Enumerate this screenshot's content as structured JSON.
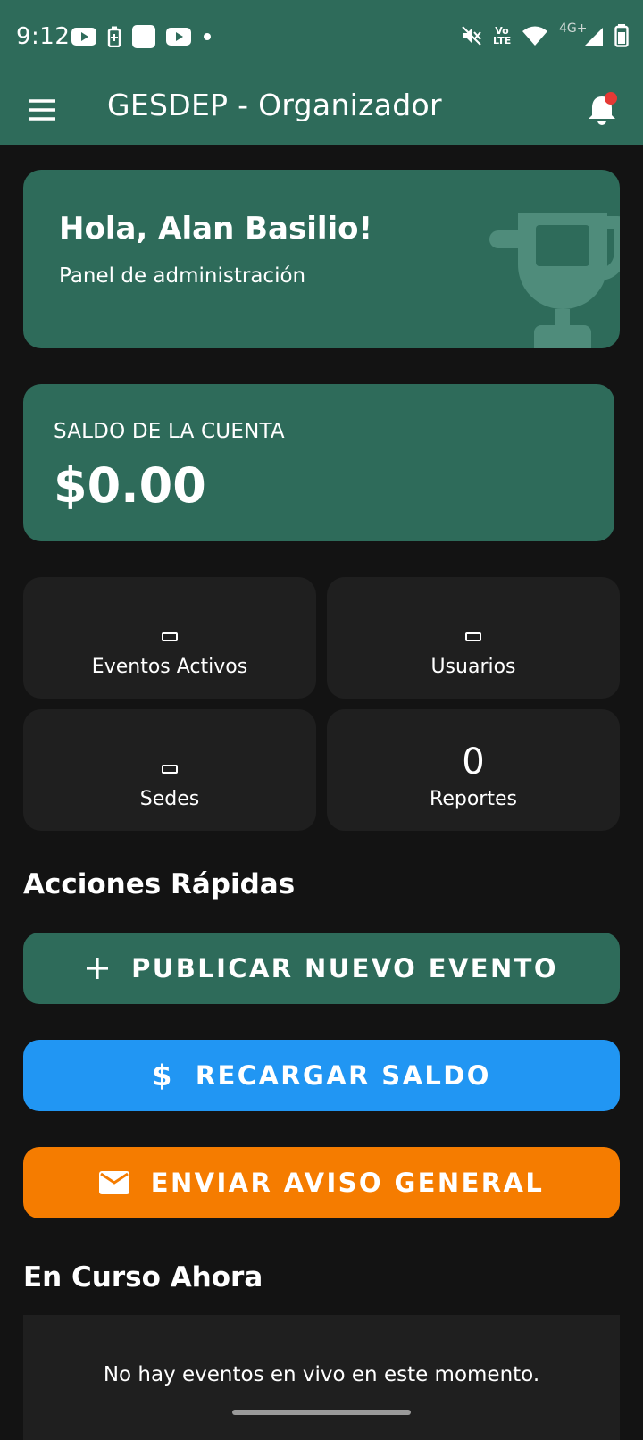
{
  "status_bar": {
    "time": "9:12",
    "network_label": "4G+",
    "volte_label": "Vo LTE",
    "icons": [
      "youtube-icon",
      "battery-saver-icon",
      "app-icon",
      "youtube-icon",
      "dot-icon",
      "mute-icon",
      "volte-icon",
      "wifi-icon",
      "signal-icon",
      "battery-icon"
    ]
  },
  "app_bar": {
    "title": "GESDEP - Organizador",
    "menu_icon": "menu-icon",
    "notification_icon": "bell-icon",
    "notification_badge_color": "#e53935"
  },
  "welcome": {
    "title": "Hola, Alan Basilio!",
    "subtitle": "Panel de administración",
    "decoration_icon": "trophy-icon"
  },
  "balance": {
    "label": "SALDO DE LA CUENTA",
    "value": "$0.00"
  },
  "stats": [
    {
      "label": "Eventos Activos",
      "value": ""
    },
    {
      "label": "Usuarios",
      "value": ""
    },
    {
      "label": "Sedes",
      "value": ""
    },
    {
      "label": "Reportes",
      "value": "0"
    }
  ],
  "quick_actions": {
    "title": "Acciones Rápidas",
    "buttons": [
      {
        "label": "PUBLICAR NUEVO EVENTO",
        "icon": "plus-icon",
        "color": "#2e6b5a"
      },
      {
        "label": "RECARGAR SALDO",
        "icon": "dollar-icon",
        "color": "#2196f3"
      },
      {
        "label": "ENVIAR AVISO GENERAL",
        "icon": "mail-icon",
        "color": "#f57c00"
      }
    ]
  },
  "live": {
    "title": "En Curso Ahora",
    "empty_message": "No hay eventos en vivo en este momento."
  },
  "colors": {
    "primary": "#2e6b5a",
    "background": "#131313",
    "card": "#1f1f1f"
  }
}
